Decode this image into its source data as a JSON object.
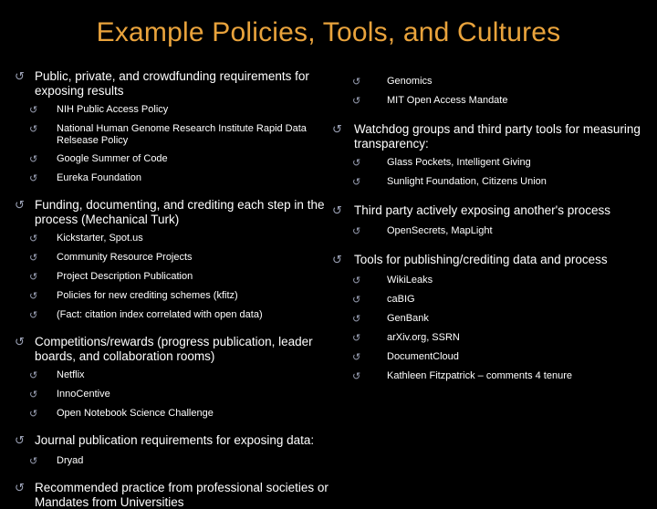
{
  "slide": {
    "title": "Example Policies, Tools, and Cultures",
    "background_color": "#000000",
    "title_color": "#e9a33c",
    "body_text_color": "#ffffff",
    "bullet_color": "#9aa0b4",
    "bullet_glyph": "↺"
  },
  "left_column": {
    "groups": [
      {
        "heading": "Public, private, and crowdfunding requirements for exposing results",
        "items": [
          "NIH Public Access Policy",
          "National Human Genome Research Institute Rapid Data Relsease Policy",
          "Google Summer of Code",
          "Eureka Foundation"
        ]
      },
      {
        "heading": "Funding, documenting, and crediting each step in the process (Mechanical Turk)",
        "items": [
          "Kickstarter, Spot.us",
          "Community Resource Projects",
          "Project Description Publication",
          "Policies for new crediting schemes (kfitz)",
          "(Fact: citation index correlated with open data)"
        ]
      },
      {
        "heading": "Competitions/rewards (progress publication, leader boards, and collaboration rooms)",
        "items": [
          "Netflix",
          "InnoCentive",
          "Open Notebook Science Challenge"
        ]
      },
      {
        "heading": "Journal publication requirements for exposing data:",
        "items": [
          "Dryad"
        ]
      },
      {
        "heading": "Recommended practice from professional societies or Mandates from Universities",
        "items": []
      }
    ]
  },
  "right_column": {
    "groups": [
      {
        "heading": "",
        "items": [
          "Genomics",
          "MIT Open Access Mandate"
        ]
      },
      {
        "heading": "Watchdog groups and third party tools for measuring transparency:",
        "items": [
          "Glass Pockets, Intelligent Giving",
          "Sunlight Foundation, Citizens Union"
        ]
      },
      {
        "heading": "Third party actively exposing another's process",
        "items": [
          "OpenSecrets, MapLight"
        ]
      },
      {
        "heading": "Tools for publishing/crediting data and process",
        "items": [
          "WikiLeaks",
          "caBIG",
          "GenBank",
          "arXiv.org, SSRN",
          "DocumentCloud",
          "Kathleen Fitzpatrick – comments 4 tenure"
        ]
      }
    ]
  }
}
